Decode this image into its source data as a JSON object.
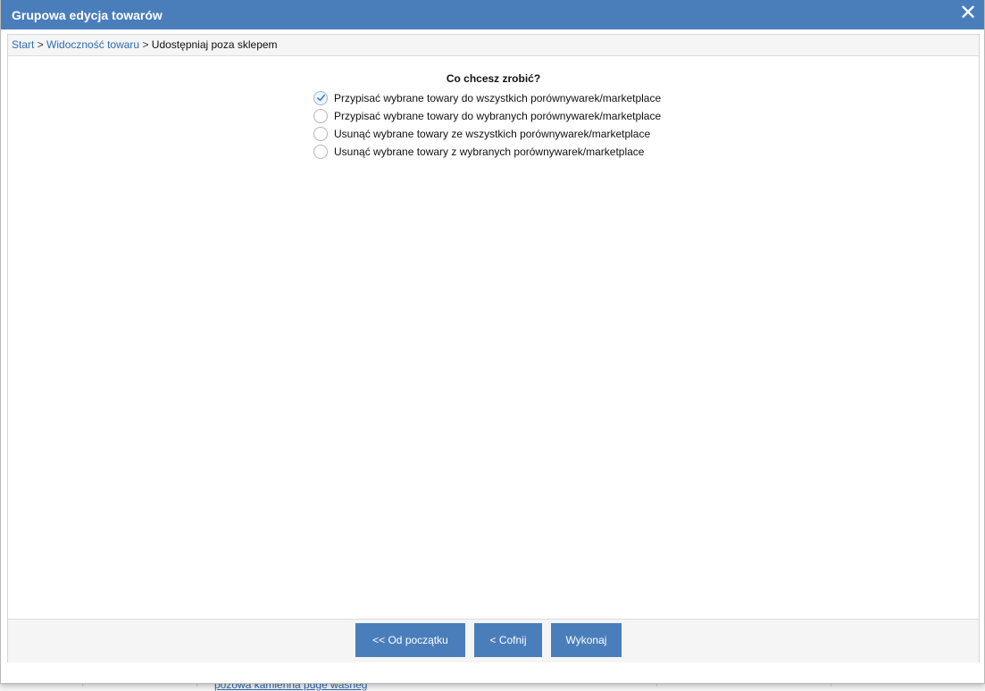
{
  "dialog": {
    "title": "Grupowa edycja towarów",
    "close_symbol": "✕"
  },
  "breadcrumb": {
    "items": [
      "Start",
      "Widoczność towaru"
    ],
    "current": "Udostępniaj poza sklepem",
    "separator": ">"
  },
  "form": {
    "question": "Co chcesz zrobić?",
    "options": [
      {
        "label": "Przypisać wybrane towary do wszystkich porównywarek/marketplace",
        "selected": true
      },
      {
        "label": "Przypisać wybrane towary do wybranych porównywarek/marketplace",
        "selected": false
      },
      {
        "label": "Usunąć wybrane towary ze wszystkich porównywarek/marketplace",
        "selected": false
      },
      {
        "label": "Usunąć wybrane towary z wybranych porównywarek/marketplace",
        "selected": false
      }
    ]
  },
  "footer": {
    "start_label": "<< Od początku",
    "back_label": "< Cofnij",
    "run_label": "Wykonaj"
  },
  "background": {
    "link_text": "pozowa kamienna pdge wasneg"
  },
  "colors": {
    "accent": "#4a7ebb",
    "link": "#2f6db5"
  }
}
